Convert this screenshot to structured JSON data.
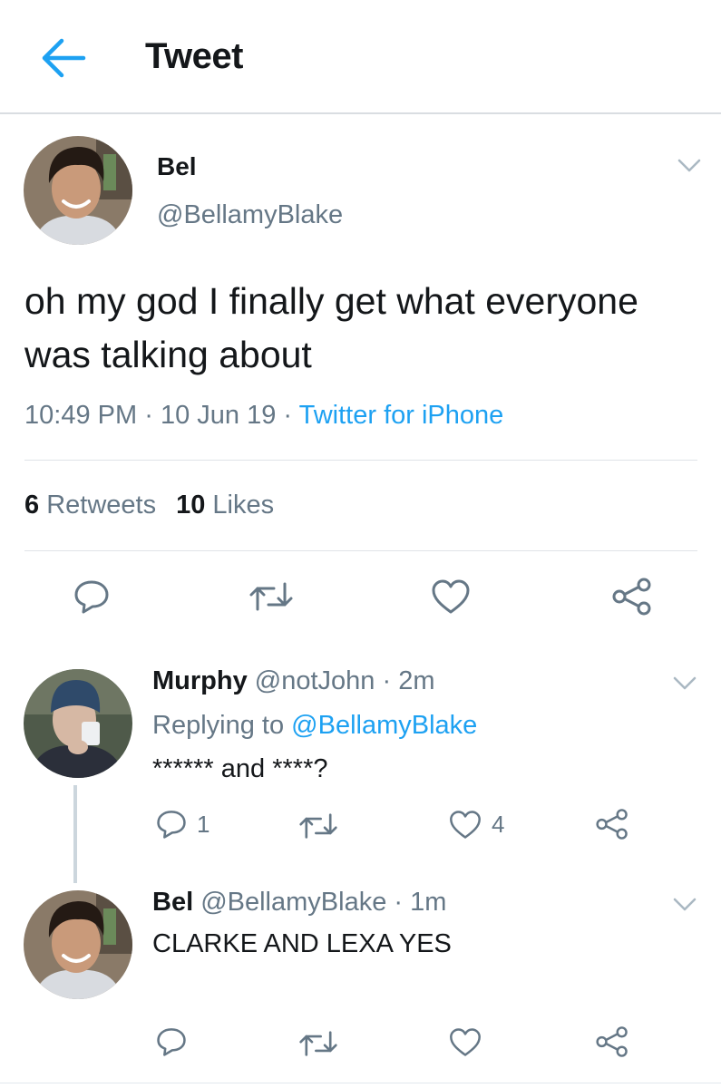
{
  "header": {
    "title": "Tweet",
    "accent": "#1da1f2"
  },
  "tweet": {
    "name": "Bel",
    "handle": "@BellamyBlake",
    "text": "oh my god I finally get what everyone was talking about",
    "time": "10:49 PM",
    "date": "10 Jun 19",
    "separator": "·",
    "source": "Twitter for iPhone",
    "retweets_count": "6",
    "retweets_label": "Retweets",
    "likes_count": "10",
    "likes_label": "Likes"
  },
  "replies": [
    {
      "name": "Murphy",
      "handle": "@notJohn",
      "sep": "·",
      "time": "2m",
      "replying_prefix": "Replying to",
      "replying_to": "@BellamyBlake",
      "text": "****** and ****?",
      "reply_count": "1",
      "like_count": "4"
    },
    {
      "name": "Bel",
      "handle": "@BellamyBlake",
      "sep": "·",
      "time": "1m",
      "text": "CLARKE AND LEXA YES"
    }
  ],
  "icons": {
    "back": "arrow-left-icon",
    "reply": "speech-bubble-icon",
    "retweet": "retweet-icon",
    "like": "heart-icon",
    "share": "share-icon",
    "menu": "chevron-down-icon"
  },
  "colors": {
    "text": "#14171a",
    "secondary": "#657786",
    "link": "#1da1f2",
    "divider": "#e1e8ed"
  }
}
